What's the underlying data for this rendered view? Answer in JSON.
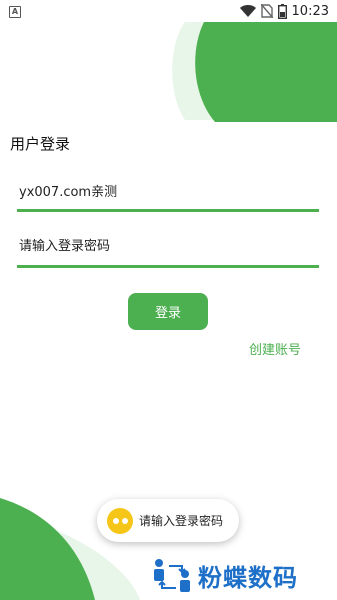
{
  "status_bar": {
    "app_icon_letter": "A",
    "time": "10:23",
    "icons": [
      "wifi-icon",
      "no-sim-icon",
      "battery-icon"
    ]
  },
  "login": {
    "title": "用户登录",
    "username_value": "yx007.com亲测",
    "password_placeholder": "请输入登录密码",
    "login_button": "登录",
    "create_account_link": "创建账号"
  },
  "toast": {
    "icon": "emoji-face-icon",
    "message": "请输入登录密码"
  },
  "watermark": {
    "text": "粉蝶数码",
    "icon": "transfer-users-icon"
  },
  "colors": {
    "accent": "#4caf50",
    "accent_light": "#e8f5e9",
    "watermark": "#1e6fc8",
    "toast_icon": "#f5c518"
  }
}
